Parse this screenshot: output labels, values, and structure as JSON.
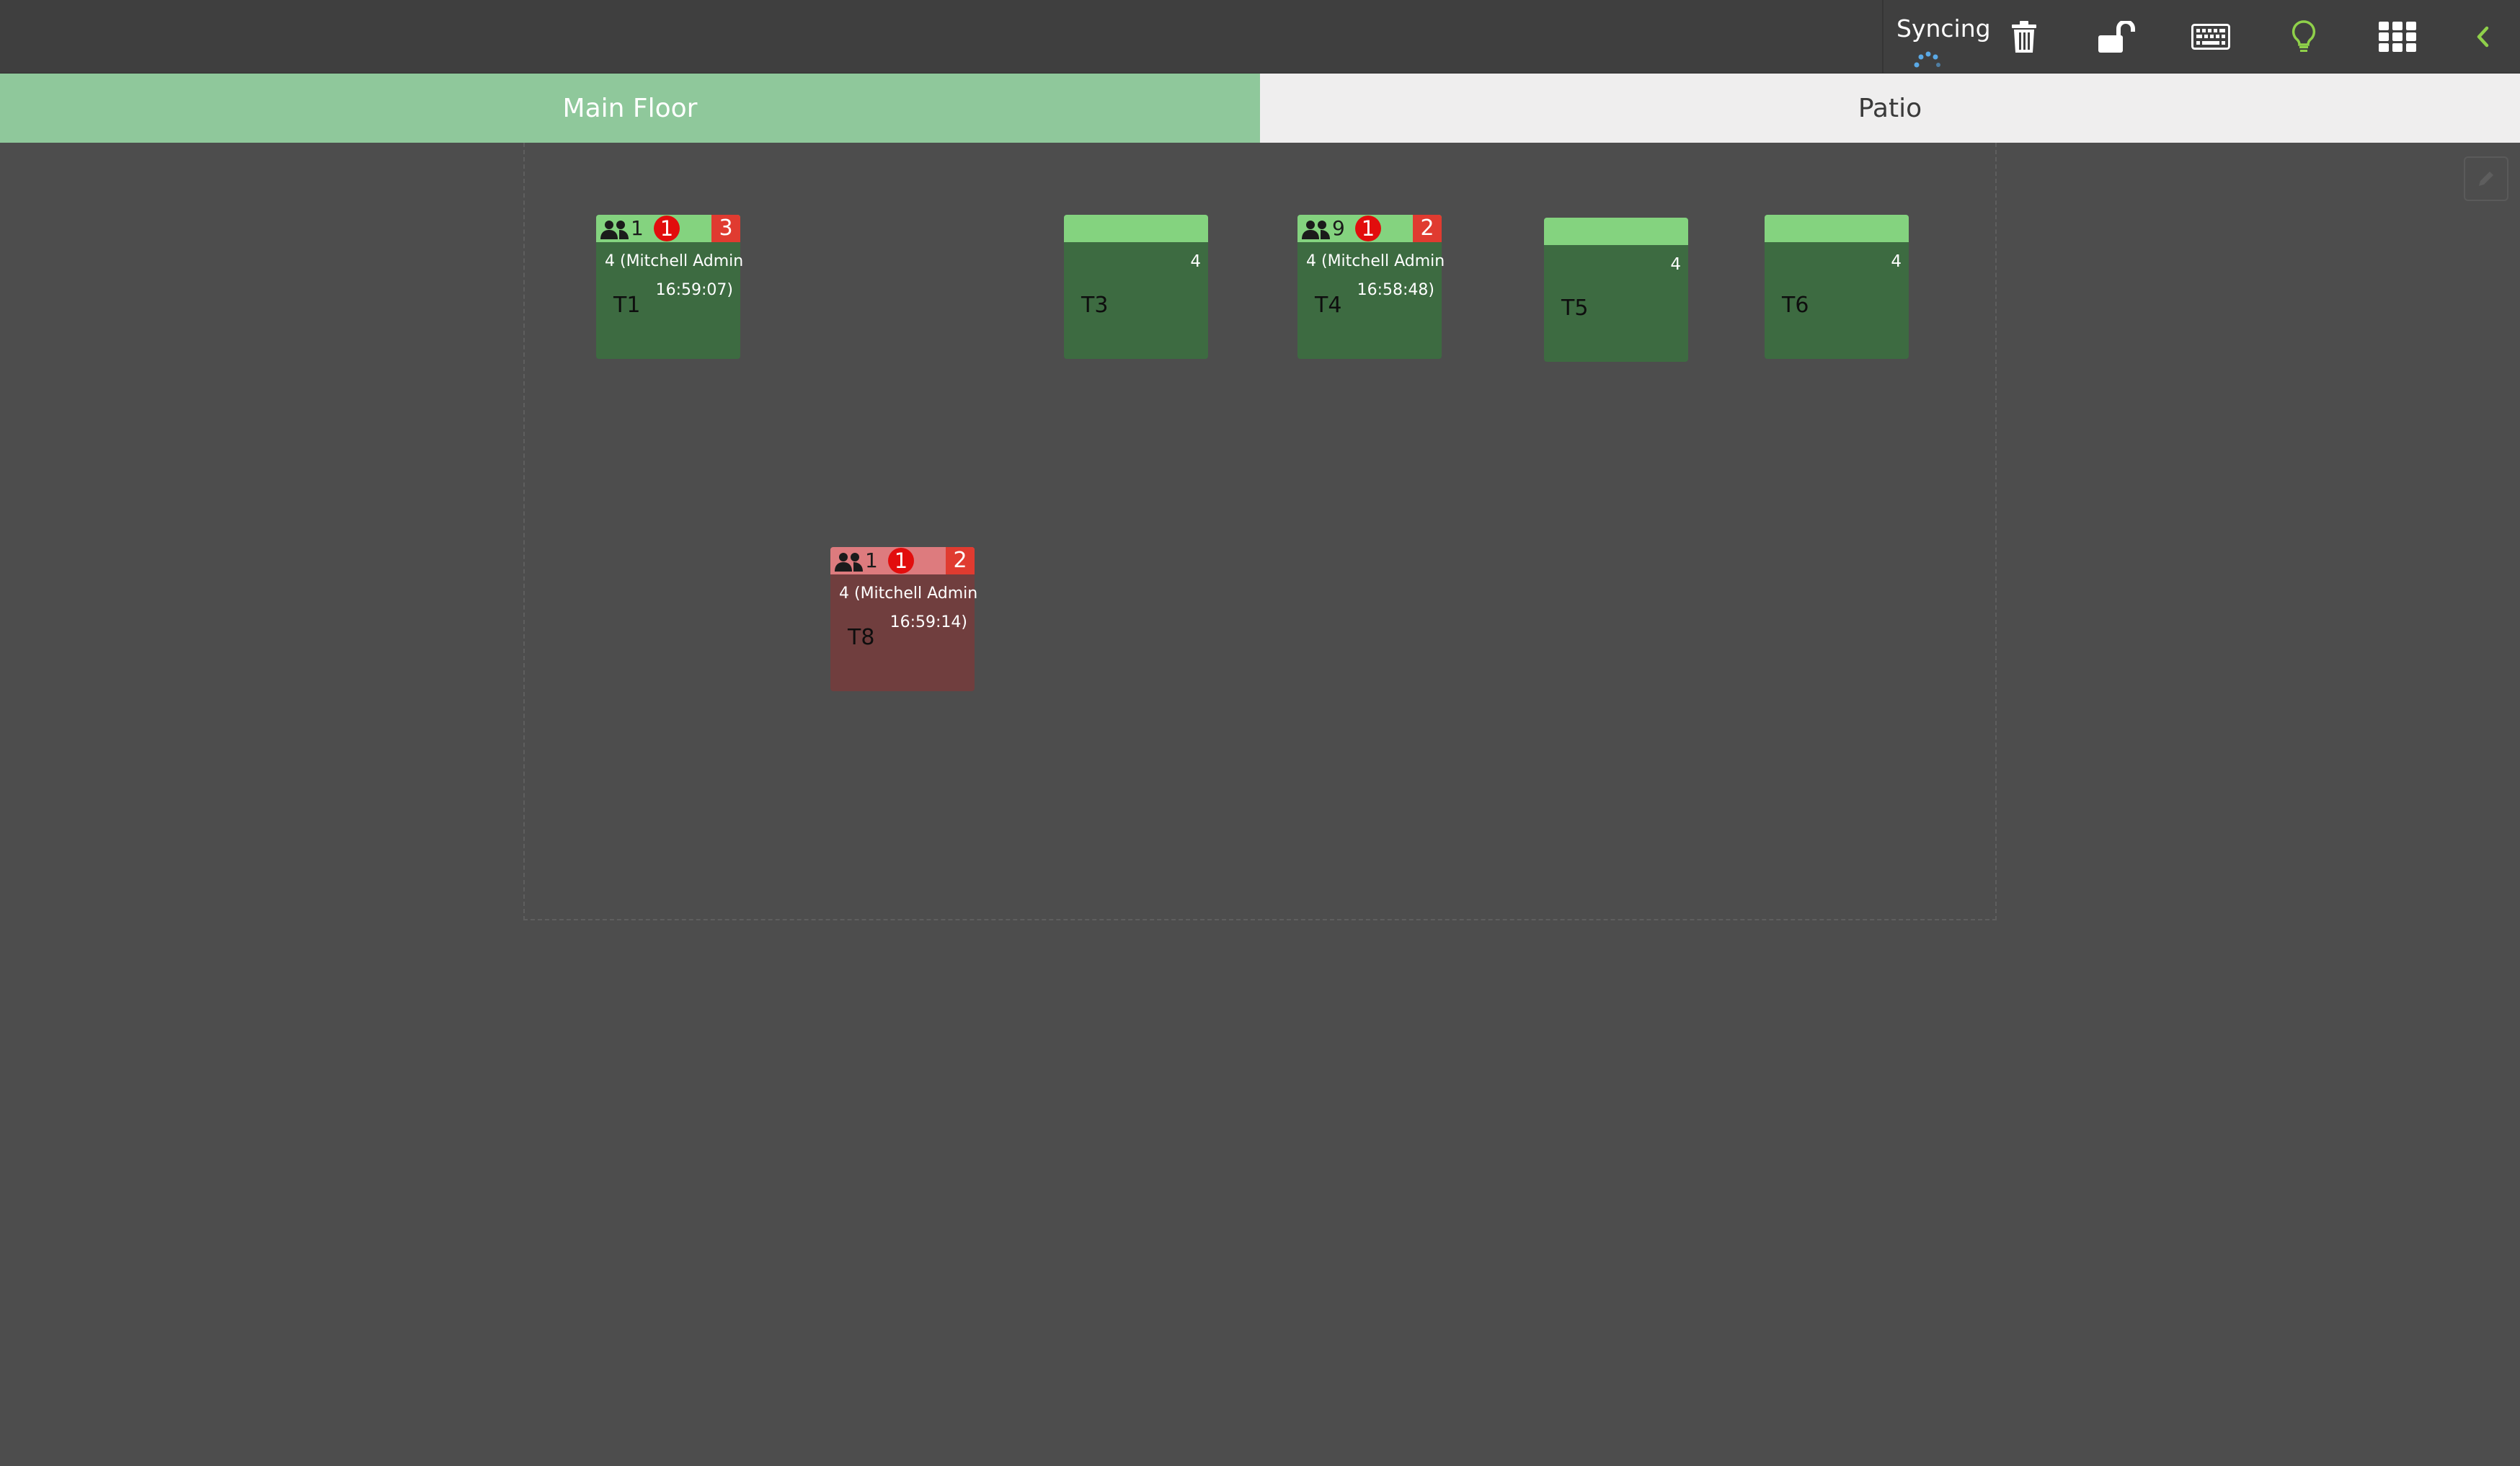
{
  "topbar": {
    "sync_status": "Syncing",
    "icons": [
      "trash-icon",
      "unlock-icon",
      "keyboard-icon",
      "lightbulb-icon",
      "apps-grid-icon",
      "chevron-left-icon"
    ],
    "colors": {
      "background": "#3f3f3f",
      "spinner": "#5aa9e6",
      "lightbulb": "#8fd04a",
      "chevron": "#8fd04a"
    }
  },
  "floors": [
    {
      "label": "Main Floor",
      "active": true,
      "color": "#8fc89b"
    },
    {
      "label": "Patio",
      "active": false,
      "color": "#efeeee"
    }
  ],
  "tables": [
    {
      "name": "T1",
      "status": "occupied",
      "guests": "1",
      "alert": "1",
      "order_count": "3",
      "order_info": "4 (Mitchell Admin",
      "order_time": "16:59:07)"
    },
    {
      "name": "T3",
      "status": "free",
      "seats": "4"
    },
    {
      "name": "T4",
      "status": "occupied",
      "guests": "9",
      "alert": "1",
      "order_count": "2",
      "order_info": "4 (Mitchell Admin",
      "order_time": "16:58:48)"
    },
    {
      "name": "T5",
      "status": "free",
      "seats": "4"
    },
    {
      "name": "T6",
      "status": "free",
      "seats": "4"
    },
    {
      "name": "T8",
      "status": "late",
      "guests": "1",
      "alert": "1",
      "order_count": "2",
      "order_info": "4 (Mitchell Admin",
      "order_time": "16:59:14)"
    }
  ],
  "colors": {
    "table_ok": "#3d6b41",
    "table_ok_header": "#84d37f",
    "table_late": "#703e3e",
    "table_late_header": "#dd7b7e",
    "alert": "#e20d0d",
    "count_badge": "#e03b30"
  }
}
